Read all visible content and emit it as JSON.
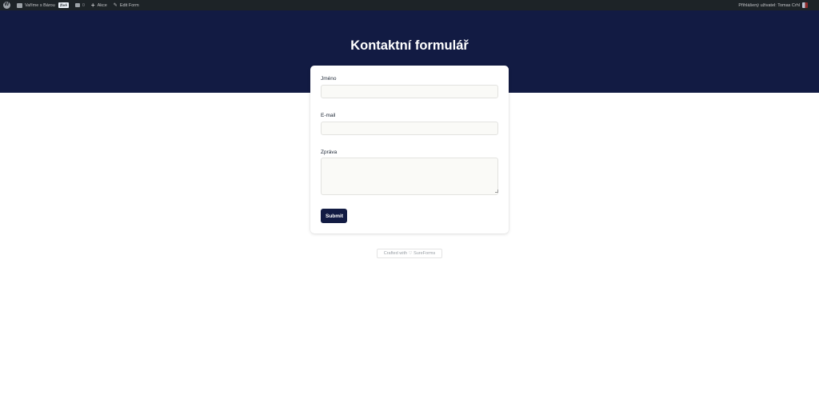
{
  "admin_bar": {
    "site_name": "Vaříme s Bárou",
    "new_badge": "Živě",
    "comment_count": "0",
    "new_label": "Akce",
    "edit_label": "Edit Form",
    "user_greeting": "Přihlášený uživatel: Tomas Crhl"
  },
  "page": {
    "title": "Kontaktní formulář"
  },
  "form": {
    "name_label": "Jméno",
    "name_value": "",
    "email_label": "E-mail",
    "email_value": "",
    "message_label": "Zpráva",
    "message_value": "",
    "submit_label": "Submit"
  },
  "footer": {
    "credit": "Crafted with ♡ SureForms"
  },
  "colors": {
    "hero_background": "#121b43",
    "admin_bar_background": "#1d2327",
    "submit_background": "#121b43"
  },
  "icons": [
    "wordpress-logo-icon",
    "home-icon",
    "comment-icon",
    "plus-icon",
    "pencil-icon"
  ]
}
